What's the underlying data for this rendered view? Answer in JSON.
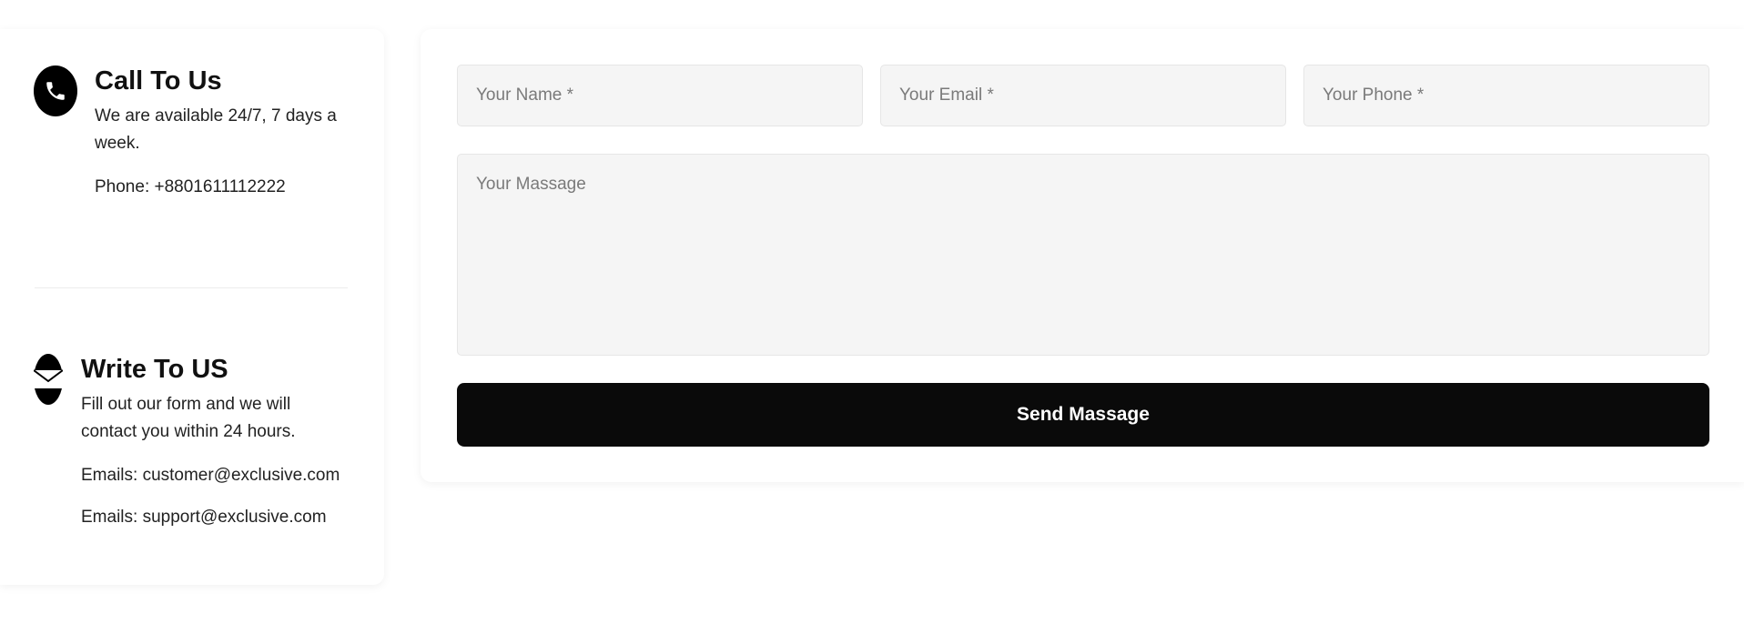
{
  "contact": {
    "call": {
      "icon": "phone-icon",
      "title": "Call To Us",
      "description": "We are available 24/7, 7 days a week.",
      "phone": "Phone: +8801611112222"
    },
    "write": {
      "icon": "mail-icon",
      "title": "Write To US",
      "description": "Fill out our form and we will contact you within 24 hours.",
      "email_customer": "Emails: customer@exclusive.com",
      "email_support": "Emails: support@exclusive.com"
    }
  },
  "form": {
    "name_placeholder": "Your Name *",
    "email_placeholder": "Your Email *",
    "phone_placeholder": "Your Phone *",
    "message_placeholder": "Your Massage",
    "submit_label": "Send Massage"
  },
  "colors": {
    "accent": "#0a0a0a",
    "field_background": "#f5f5f5",
    "placeholder": "#7a7a7a"
  }
}
